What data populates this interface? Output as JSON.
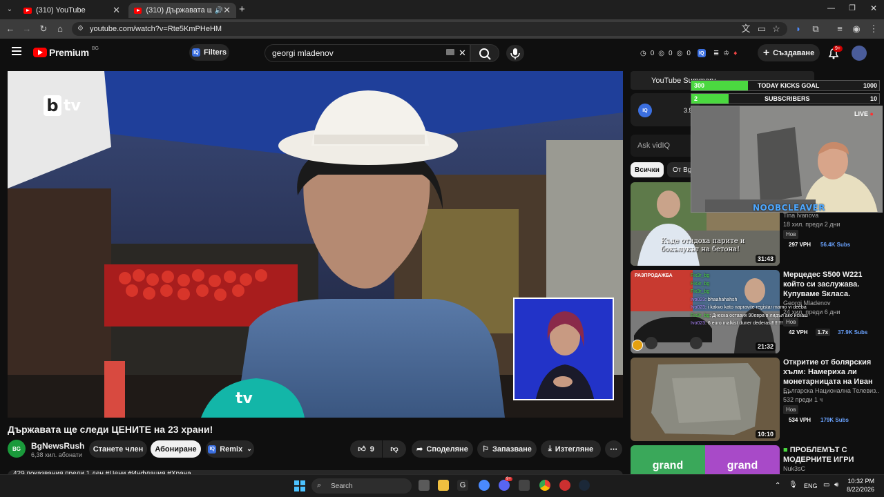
{
  "browser": {
    "tabs": [
      {
        "title": "(310) YouTube",
        "active": false
      },
      {
        "title": "(310) Държавата ще следи",
        "active": true
      }
    ],
    "new_tab_icon": "+",
    "url": "youtube.com/watch?v=Rte5KmPHeHM",
    "window_controls": [
      "minimize-icon",
      "restore-icon",
      "close-icon"
    ]
  },
  "header": {
    "logo_text": "Premium",
    "logo_region": "BG",
    "filters_label": "Filters",
    "search_value": "georgi mladenov",
    "stats": [
      "0",
      "0",
      "0"
    ],
    "create_label": "Създаване",
    "notif_count": "9+"
  },
  "video": {
    "channel_logo": "tv",
    "title": "Държавата ще следи ЦЕНИТЕ на 23 храни!",
    "mic_brand": "tv"
  },
  "channel": {
    "avatar_text": "BG",
    "name": "BgNewsRush",
    "subs": "6,38 хил. абонати",
    "join_label": "Станете член",
    "subscribe_label": "Абониране",
    "remix_label": "Remix"
  },
  "actions": {
    "like_count": "9",
    "share_label": "Споделяне",
    "save_label": "Запазване",
    "download_label": "Изтегляне"
  },
  "description_preview": "429 показвания  преди 1 ден  #Цени #Инфлация #Храна",
  "sidebar": {
    "summary_label": "YouTube Summary",
    "iq_value": "3.5",
    "ask_placeholder": "Ask vidIQ",
    "chip_all": "Всички",
    "chip_from": "От Bg"
  },
  "overlay": {
    "goal1": {
      "left": "300",
      "label": "TODAY KICKS GOAL",
      "right": "1000",
      "fraction": 0.3
    },
    "goal2": {
      "left": "2",
      "label": "SUBSCRIBERS",
      "right": "10",
      "fraction": 0.2
    },
    "live_label": "LIVE",
    "streamer_name": "NOOBCLEAVER"
  },
  "recommendations": [
    {
      "title": "",
      "channel": "Tina Ivanova",
      "meta": "18 хил.  преди 2 дни",
      "badge": "Нов",
      "vph": "297 VPH",
      "extra": "56.4K Subs",
      "duration": "31:43",
      "caption": "Къде отидоха парите и бокълукът на бетона!"
    },
    {
      "title": "Мерцедес S500 W221 който си заслужава. Купуваме Sкласа.",
      "channel": "Georgi Mladenov",
      "meta": "24 хил.  преди 6 дни",
      "badge": "Нов",
      "vph": "42 VPH",
      "ratio": "1.7x",
      "extra": "37.9K Subs",
      "duration": "21:32",
      "sign": "РАЗПРОДАЖБА"
    },
    {
      "title": "Откритие от болярския хълм: Намериха ли монетарницата на Иван ...",
      "channel": "Българска Национална Телевиз...",
      "meta": "532  преди 1 ч",
      "badge": "Нов",
      "vph": "534 VPH",
      "extra": "179K Subs",
      "duration": "10:10"
    },
    {
      "title": "ПРОБЛЕМЪТ С МОДЕРНИТЕ ИГРИ",
      "channel": "Nuk3sC",
      "meta": ""
    }
  ],
  "chat": [
    {
      "user": "Fix3r_bg",
      "msg": ""
    },
    {
      "user": "Fix3r_bg",
      "msg": ""
    },
    {
      "user": "Fix3r_bg",
      "msg": ""
    },
    {
      "user": "Ivo023",
      "msg": "bhaahahahsh"
    },
    {
      "user": "Ivo023",
      "msg": "i kakvo kato napravite registar mamo vi deeba"
    },
    {
      "user": "Fix3r_bg",
      "msg": "Днеска оставих 90евра в лидъл ако искаш"
    },
    {
      "user": "Ivo023",
      "msg": "6 euro malkist duner dederast!!!!!!!!!!!"
    }
  ],
  "taskbar": {
    "search_placeholder": "Search",
    "lang": "ENG",
    "time": "10:32 PM",
    "date": "8/22/2026",
    "discord_badge": "9+"
  },
  "colors": {
    "accent_red": "#ff0000",
    "btv_teal": "#13b6a8",
    "goal_green": "#4bd840"
  }
}
